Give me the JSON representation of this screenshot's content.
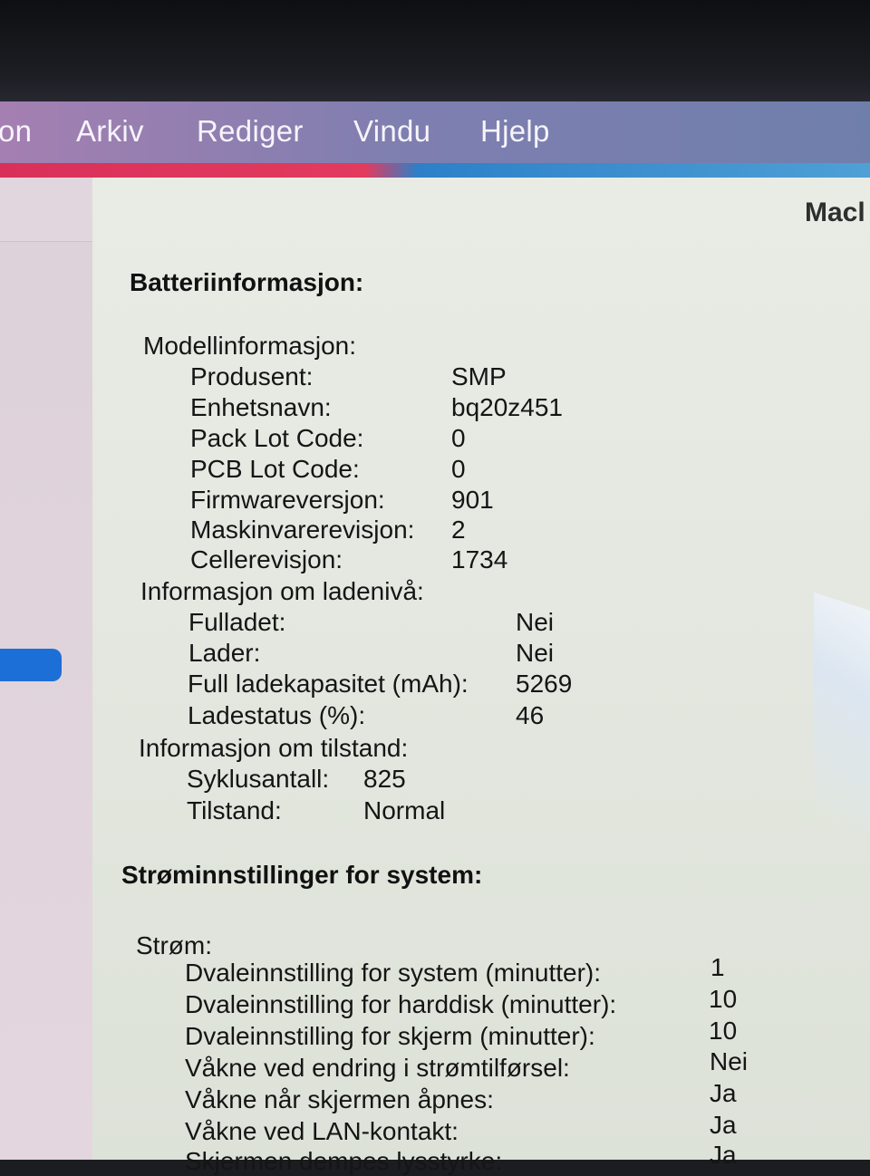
{
  "menubar": {
    "app_name_fragment": "on",
    "items": [
      "Arkiv",
      "Rediger",
      "Vindu",
      "Hjelp"
    ]
  },
  "device_title_fragment": "Macl",
  "battery": {
    "heading": "Batteriinformasjon:",
    "model": {
      "label": "Modellinformasjon:",
      "rows": [
        {
          "label": "Produsent:",
          "value": "SMP"
        },
        {
          "label": "Enhetsnavn:",
          "value": "bq20z451"
        },
        {
          "label": "Pack Lot Code:",
          "value": "0"
        },
        {
          "label": "PCB Lot Code:",
          "value": "0"
        },
        {
          "label": "Firmwareversjon:",
          "value": "901"
        },
        {
          "label": "Maskinvarerevisjon:",
          "value": "2"
        },
        {
          "label": "Cellerevisjon:",
          "value": "1734"
        }
      ]
    },
    "charge": {
      "label": "Informasjon om ladenivå:",
      "rows": [
        {
          "label": "Fulladet:",
          "value": "Nei"
        },
        {
          "label": "Lader:",
          "value": "Nei"
        },
        {
          "label": "Full ladekapasitet (mAh):",
          "value": "5269"
        },
        {
          "label": "Ladestatus (%):",
          "value": "46"
        }
      ]
    },
    "health": {
      "label": "Informasjon om tilstand:",
      "rows": [
        {
          "label": "Syklusantall:",
          "value": "825"
        },
        {
          "label": "Tilstand:",
          "value": "Normal"
        }
      ]
    }
  },
  "power": {
    "heading": "Strøminnstillinger for system:",
    "section_label": "Strøm:",
    "rows": [
      {
        "label": "Dvaleinnstilling for system (minutter):",
        "value": "1"
      },
      {
        "label": "Dvaleinnstilling for harddisk (minutter):",
        "value": "10"
      },
      {
        "label": "Dvaleinnstilling for skjerm (minutter):",
        "value": "10"
      },
      {
        "label": "Våkne ved endring i strømtilførsel:",
        "value": "Nei"
      },
      {
        "label": "Våkne når skjermen åpnes:",
        "value": "Ja"
      },
      {
        "label": "Våkne ved LAN-kontakt:",
        "value": "Ja"
      },
      {
        "label": "Skjermen dempes lysstyrke:",
        "value": "Ja"
      }
    ]
  }
}
